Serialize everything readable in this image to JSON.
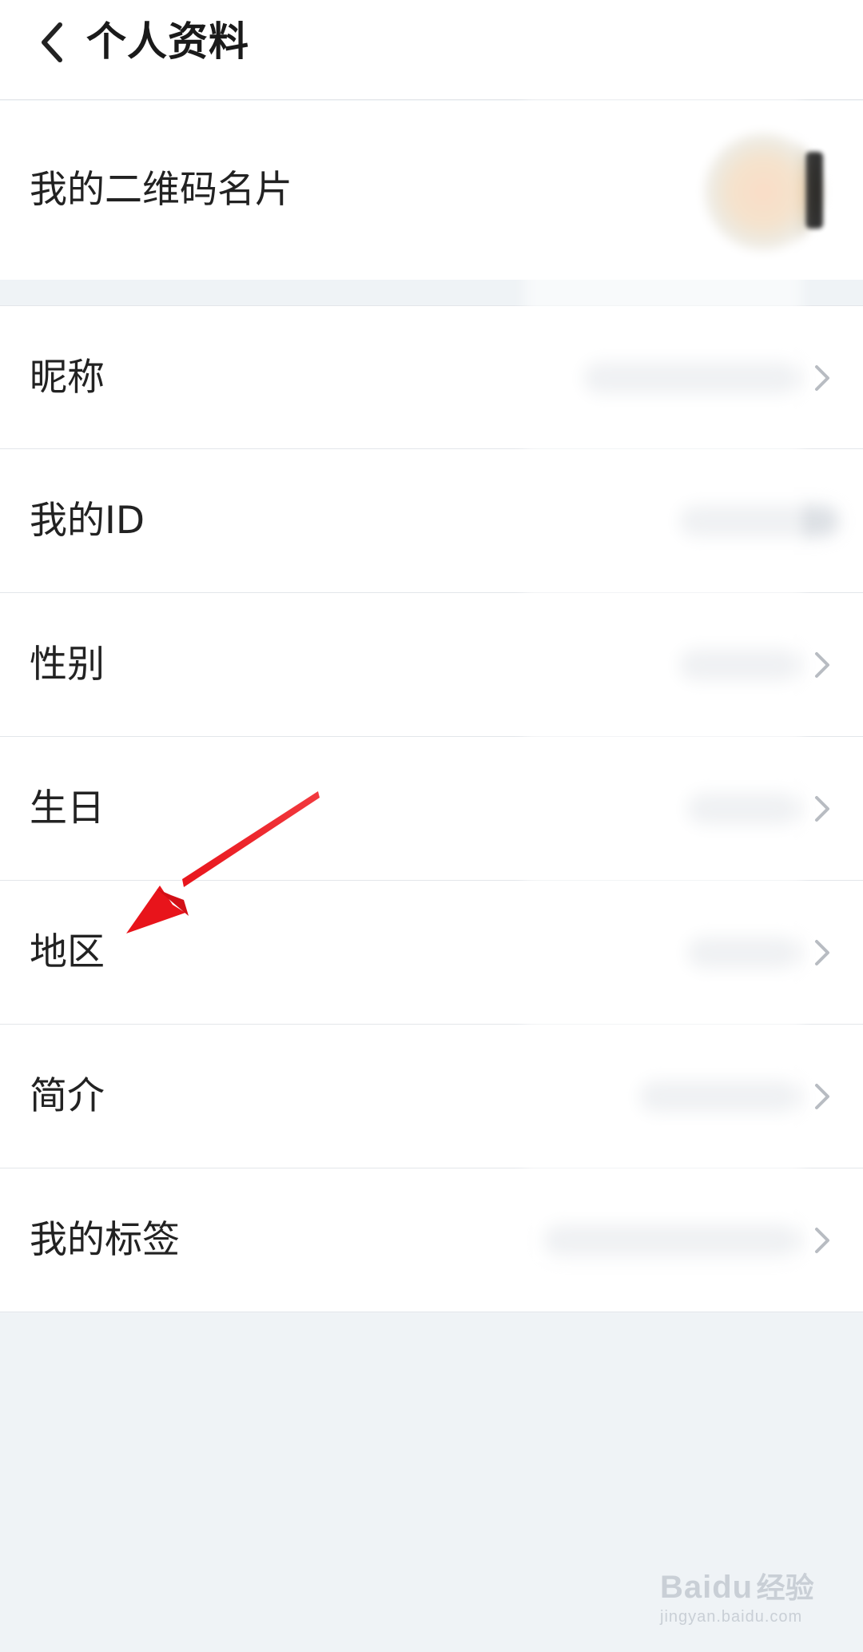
{
  "header": {
    "title": "个人资料",
    "back_icon": "chevron-left-icon"
  },
  "qr_card": {
    "label": "我的二维码名片"
  },
  "rows": [
    {
      "label": "昵称",
      "has_chevron": true,
      "value_blurred": true
    },
    {
      "label": "我的ID",
      "has_chevron": false,
      "value_blurred": true
    },
    {
      "label": "性别",
      "has_chevron": true,
      "value_blurred": true
    },
    {
      "label": "生日",
      "has_chevron": true,
      "value_blurred": true
    },
    {
      "label": "地区",
      "has_chevron": true,
      "value_blurred": true
    },
    {
      "label": "简介",
      "has_chevron": true,
      "value_blurred": true
    },
    {
      "label": "我的标签",
      "has_chevron": true,
      "value_blurred": true
    }
  ],
  "annotation": {
    "arrow_color": "#e8141b",
    "points_to": "地区"
  },
  "watermark": {
    "logo": "Bai",
    "logo_suffix": "du",
    "text": "经验",
    "url": "jingyan.baidu.com"
  },
  "colors": {
    "background": "#eff3f6",
    "card": "#ffffff",
    "text": "#222222",
    "chevron": "#b8bcc2"
  }
}
